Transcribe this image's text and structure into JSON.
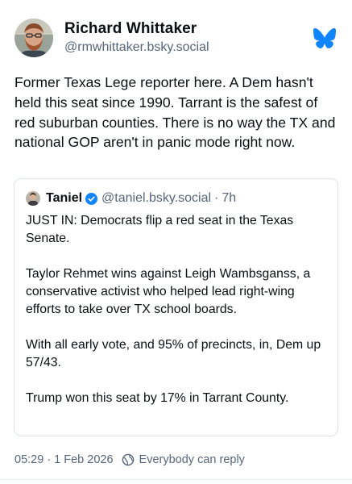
{
  "post": {
    "author": {
      "display_name": "Richard Whittaker",
      "handle": "@rmwhittaker.bsky.social"
    },
    "logo_icon": "bluesky-butterfly-icon",
    "text": "Former Texas Lege reporter here. A Dem hasn't held this seat since 1990. Tarrant is the safest of red suburban counties. There is no way the TX and national GOP aren't in panic mode right now.",
    "quote": {
      "author_name": "Taniel",
      "verified_icon": "verified-check-icon",
      "author_handle": "@taniel.bsky.social",
      "separator": "·",
      "time_ago": "7h",
      "paragraphs": [
        "JUST IN: Democrats flip a red seat in the Texas Senate.",
        "Taylor Rehmet wins against Leigh Wambsganss, a conservative activist who helped lead right-wing efforts to take over TX school boards.",
        "With all early vote, and 95% of precincts, in, Dem up 57/43.",
        "Trump won this seat by 17% in Tarrant County."
      ]
    },
    "timestamp": "05:29 · 1 Feb 2026",
    "reply_setting": {
      "icon": "globe-reply-icon",
      "label": "Everybody can reply"
    }
  },
  "colors": {
    "text_primary": "#0b0f14",
    "text_secondary": "#56667a",
    "brand_blue": "#1185fe",
    "border": "#dde3ea"
  }
}
